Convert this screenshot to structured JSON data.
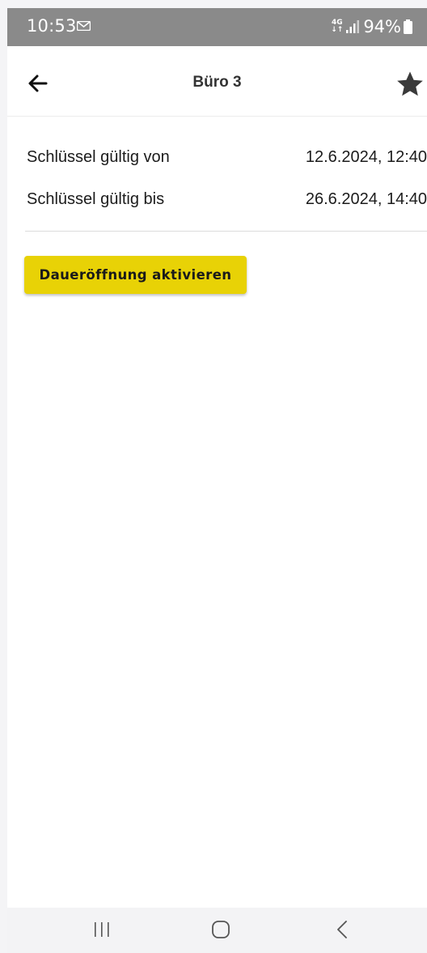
{
  "status_bar": {
    "time": "10:53",
    "network": "4G",
    "battery": "94%",
    "icons": [
      "message-icon",
      "signal-icon",
      "battery-icon"
    ]
  },
  "app_bar": {
    "title": "Büro 3",
    "back_icon": "arrow-left-icon",
    "favorite_icon": "star-icon"
  },
  "key_info": [
    {
      "label": "Schlüssel gültig von",
      "value": "12.6.2024, 12:40"
    },
    {
      "label": "Schlüssel gültig bis",
      "value": "26.6.2024, 14:40"
    }
  ],
  "actions": {
    "permanent_open_label": "Daueröffnung aktivieren",
    "accent_color": "#e8d206"
  },
  "nav_bar": {
    "icons": [
      "recents-icon",
      "home-icon",
      "back-icon"
    ]
  }
}
